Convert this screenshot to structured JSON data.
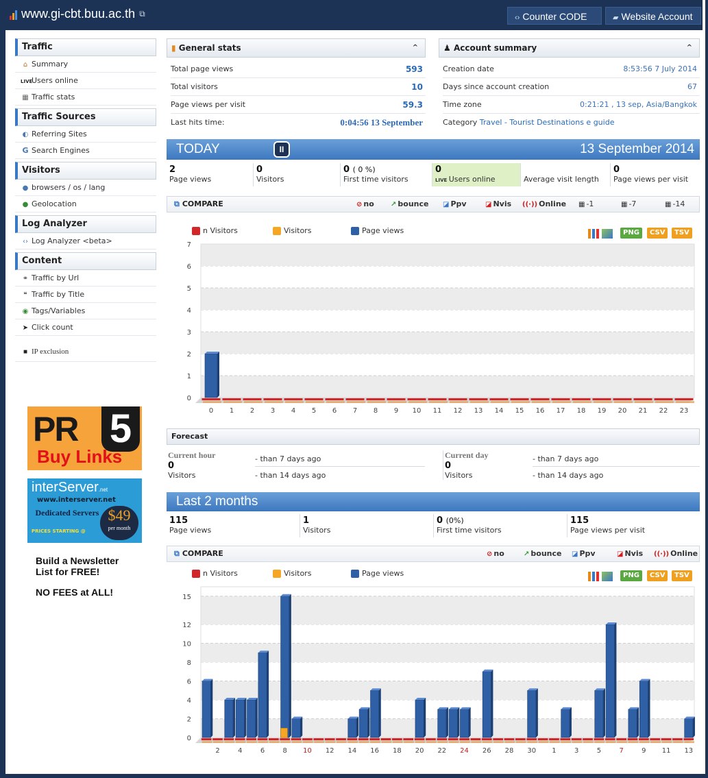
{
  "header": {
    "site": "www.gi-cbt.buu.ac.th",
    "counter_code": "Counter CODE",
    "website_account": "Website Account"
  },
  "sidebar": {
    "sections": [
      {
        "title": "Traffic",
        "items": [
          {
            "label": "Summary",
            "icon": "home-icon"
          },
          {
            "label": "Users online",
            "icon": "live-icon"
          },
          {
            "label": "Traffic stats",
            "icon": "calendar-icon"
          }
        ]
      },
      {
        "title": "Traffic Sources",
        "items": [
          {
            "label": "Referring Sites",
            "icon": "referrer-icon"
          },
          {
            "label": "Search Engines",
            "icon": "google-icon"
          }
        ]
      },
      {
        "title": "Visitors",
        "items": [
          {
            "label": "browsers / os / lang",
            "icon": "info-icon"
          },
          {
            "label": "Geolocation",
            "icon": "globe-icon"
          }
        ]
      },
      {
        "title": "Log Analyzer",
        "items": [
          {
            "label": "Log Analyzer <beta>",
            "icon": "code-icon"
          }
        ]
      },
      {
        "title": "Content",
        "items": [
          {
            "label": "Traffic by Url",
            "icon": "link-icon"
          },
          {
            "label": "Traffic by Title",
            "icon": "title-icon"
          },
          {
            "label": "Tags/Variables",
            "icon": "tag-icon"
          },
          {
            "label": "Click count",
            "icon": "cursor-icon"
          }
        ]
      }
    ],
    "ip_exclusion": "IP exclusion",
    "ads": {
      "pr_big": "PR",
      "pr_num": "5",
      "pr_buy": "Buy Links",
      "is_brand": "interServer",
      "is_brand_suffix": ".net",
      "is_url": "www.interserver.net",
      "is_dedicated": "Dedicated Servers",
      "is_prices": "PRICES STARTING @",
      "is_price": "$49",
      "is_per": "per month",
      "nl_line1": "Build a Newsletter",
      "nl_line2": "List for FREE!",
      "nl_line3": "NO FEES at ALL!"
    }
  },
  "general": {
    "title": "General stats",
    "rows": [
      {
        "label": "Total page views",
        "value": "593"
      },
      {
        "label": "Total visitors",
        "value": "10"
      },
      {
        "label": "Page views per visit",
        "value": "59.3"
      },
      {
        "label": "Last hits time:",
        "value": "0:04:56 13 September"
      }
    ]
  },
  "account": {
    "title": "Account summary",
    "rows": [
      {
        "label": "Creation date",
        "value": "8:53:56 7 July 2014"
      },
      {
        "label": "Days since account creation",
        "value": "67"
      },
      {
        "label": "Time zone",
        "value": "0:21:21 , 13 sep, Asia/Bangkok"
      }
    ],
    "category_label": "Category",
    "category_value": "Travel - Tourist Destinations e guide"
  },
  "today": {
    "title": "TODAY",
    "date": "13 September 2014",
    "kpis": [
      {
        "num": "2",
        "extra": "",
        "label": "Page views"
      },
      {
        "num": "0",
        "extra": "",
        "label": "Visitors"
      },
      {
        "num": "0",
        "extra": "( 0 %)",
        "label": "First time visitors"
      },
      {
        "num": "0",
        "extra": "",
        "label": "Users online"
      },
      {
        "num": "",
        "extra": "",
        "label": "Average visit length"
      },
      {
        "num": "0",
        "extra": "",
        "label": "Page views per visit"
      }
    ],
    "compare": "COMPARE",
    "options": [
      "no",
      "bounce",
      "Ppv",
      "Nvis",
      "Online",
      "-1",
      "-7",
      "-14"
    ]
  },
  "legend": [
    "n Visitors",
    "Visitors",
    "Page views"
  ],
  "export": [
    "PNG",
    "CSV",
    "TSV"
  ],
  "colors": {
    "pageviews": "#2f5fa5",
    "visitors": "#f5a623",
    "nvisitors": "#d0282a",
    "accent": "#3b78c4",
    "navy": "#1c3355"
  },
  "forecast": {
    "title": "Forecast",
    "current_hour": "Current hour",
    "current_day": "Current day",
    "hour_value": "0",
    "day_value": "0",
    "unit": "Visitors",
    "l7": "- than 7 days ago",
    "l14": "- than 14 days ago"
  },
  "last2": {
    "title": "Last 2 months",
    "kpis": [
      {
        "num": "115",
        "extra": "",
        "label": "Page views"
      },
      {
        "num": "1",
        "extra": "",
        "label": "Visitors"
      },
      {
        "num": "0",
        "extra": "(0%)",
        "label": "First time visitors"
      },
      {
        "num": "115",
        "extra": "",
        "label": "Page views per visit"
      }
    ],
    "compare": "COMPARE",
    "options": [
      "no",
      "bounce",
      "Ppv",
      "Nvis",
      "Online"
    ]
  },
  "chart_data": [
    {
      "type": "bar",
      "categories": [
        "0",
        "1",
        "2",
        "3",
        "4",
        "5",
        "6",
        "7",
        "8",
        "9",
        "10",
        "11",
        "12",
        "13",
        "14",
        "15",
        "16",
        "17",
        "18",
        "19",
        "20",
        "21",
        "22",
        "23"
      ],
      "series": [
        {
          "name": "Page views",
          "values": [
            2,
            0,
            0,
            0,
            0,
            0,
            0,
            0,
            0,
            0,
            0,
            0,
            0,
            0,
            0,
            0,
            0,
            0,
            0,
            0,
            0,
            0,
            0,
            0
          ]
        },
        {
          "name": "Visitors",
          "values": [
            0,
            0,
            0,
            0,
            0,
            0,
            0,
            0,
            0,
            0,
            0,
            0,
            0,
            0,
            0,
            0,
            0,
            0,
            0,
            0,
            0,
            0,
            0,
            0
          ]
        },
        {
          "name": "n Visitors",
          "values": [
            0,
            0,
            0,
            0,
            0,
            0,
            0,
            0,
            0,
            0,
            0,
            0,
            0,
            0,
            0,
            0,
            0,
            0,
            0,
            0,
            0,
            0,
            0,
            0
          ]
        }
      ],
      "ylim": [
        0,
        7
      ],
      "yticks": [
        0,
        1,
        2,
        3,
        4,
        5,
        6,
        7
      ],
      "grid": true,
      "legend": "top-left"
    },
    {
      "type": "bar",
      "categories": [
        "1",
        "2",
        "3",
        "4",
        "5",
        "6",
        "7",
        "8",
        "9",
        "10",
        "11",
        "12",
        "13",
        "14",
        "15",
        "16",
        "17",
        "18",
        "19",
        "20",
        "21",
        "22",
        "23",
        "24",
        "25",
        "26",
        "27",
        "28",
        "29",
        "30",
        "31",
        "1",
        "2",
        "3",
        "4",
        "5",
        "6",
        "7",
        "8",
        "9",
        "10",
        "11",
        "12",
        "13"
      ],
      "tick_labels": [
        "2",
        "4",
        "6",
        "8",
        "10",
        "12",
        "14",
        "16",
        "18",
        "20",
        "22",
        "24",
        "26",
        "28",
        "30",
        "1",
        "3",
        "5",
        "7",
        "9",
        "11",
        "13"
      ],
      "red_ticks": [
        "10",
        "24",
        "7"
      ],
      "series": [
        {
          "name": "Page views",
          "values": [
            6,
            0,
            4,
            4,
            4,
            9,
            0,
            15,
            2,
            0,
            0,
            0,
            0,
            2,
            3,
            5,
            0,
            0,
            0,
            4,
            0,
            3,
            3,
            3,
            0,
            7,
            0,
            0,
            0,
            5,
            0,
            0,
            3,
            0,
            0,
            5,
            12,
            0,
            3,
            6,
            0,
            0,
            0,
            2
          ]
        },
        {
          "name": "Visitors",
          "values": [
            0,
            0,
            0,
            0,
            0,
            0,
            0,
            1,
            0,
            0,
            0,
            0,
            0,
            0,
            0,
            0,
            0,
            0,
            0,
            0,
            0,
            0,
            0,
            0,
            0,
            0,
            0,
            0,
            0,
            0,
            0,
            0,
            0,
            0,
            0,
            0,
            0,
            0,
            0,
            0,
            0,
            0,
            0,
            0
          ]
        },
        {
          "name": "n Visitors",
          "values": [
            0,
            0,
            0,
            0,
            0,
            0,
            0,
            0,
            0,
            0,
            0,
            0,
            0,
            0,
            0,
            0,
            0,
            0,
            0,
            0,
            0,
            0,
            0,
            0,
            0,
            0,
            0,
            0,
            0,
            0,
            0,
            0,
            0,
            0,
            0,
            0,
            0,
            0,
            0,
            0,
            0,
            0,
            0,
            0
          ]
        }
      ],
      "ylim": [
        0,
        16
      ],
      "yticks": [
        0,
        2,
        4,
        6,
        8,
        10,
        12,
        15
      ],
      "grid": true,
      "legend": "top-left"
    }
  ]
}
